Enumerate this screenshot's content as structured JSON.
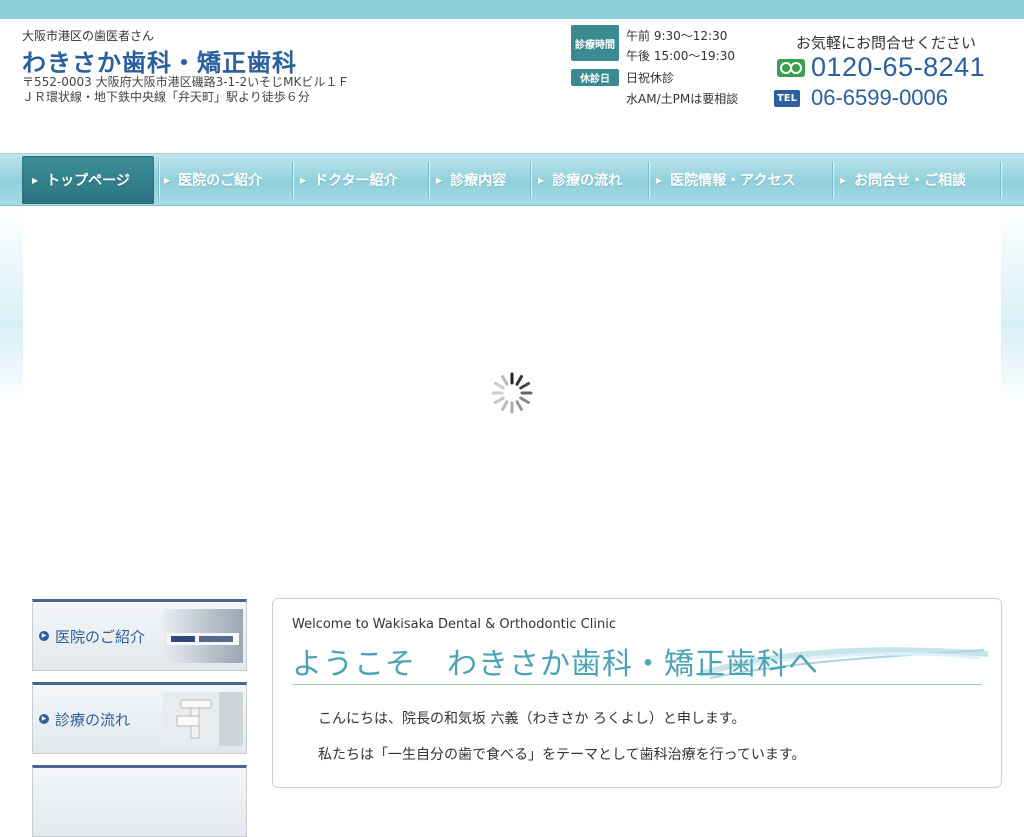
{
  "header": {
    "tagline": "大阪市港区の歯医者さん",
    "clinic_name": "わきさか歯科・矯正歯科",
    "address_line1": "〒552-0003 大阪府大阪市港区磯路3-1-2いそじMKビル１Ｆ",
    "address_line2": "ＪＲ環状線・地下鉄中央線「弁天町」駅より徒歩６分"
  },
  "hours": {
    "badge": "診療時間",
    "morning": "午前 9:30〜12:30",
    "afternoon": "午後 15:00〜19:30",
    "closed_badge": "休診日",
    "closed_days": "日祝休診",
    "note": "水AM/土PMは要相談"
  },
  "contact": {
    "title": "お気軽にお問合せください",
    "free_dial": "0120-65-8241",
    "tel_label": "TEL",
    "tel": "06-6599-0006"
  },
  "nav": {
    "items": [
      {
        "label": "トップページ"
      },
      {
        "label": "医院のご紹介"
      },
      {
        "label": "ドクター紹介"
      },
      {
        "label": "診療内容"
      },
      {
        "label": "診療の流れ"
      },
      {
        "label": "医院情報・アクセス"
      },
      {
        "label": "お問合せ・ご相談"
      }
    ],
    "active_index": 0
  },
  "sidebar": {
    "cards": [
      {
        "label": "医院のご紹介"
      },
      {
        "label": "診療の流れ"
      }
    ]
  },
  "welcome": {
    "en": "Welcome to Wakisaka Dental & Orthodontic Clinic",
    "jp": "ようこそ　わきさか歯科・矯正歯科へ",
    "para1": "こんにちは、院長の和気坂 六義（わきさか ろくよし）と申します。",
    "para2": "私たちは「一生自分の歯で食べる」をテーマとして歯科治療を行っています。"
  },
  "colors": {
    "brand": "#2b5f9e",
    "nav": "#8fd0dc",
    "accent": "#3b8a8f",
    "heading": "#4aa4b4"
  }
}
